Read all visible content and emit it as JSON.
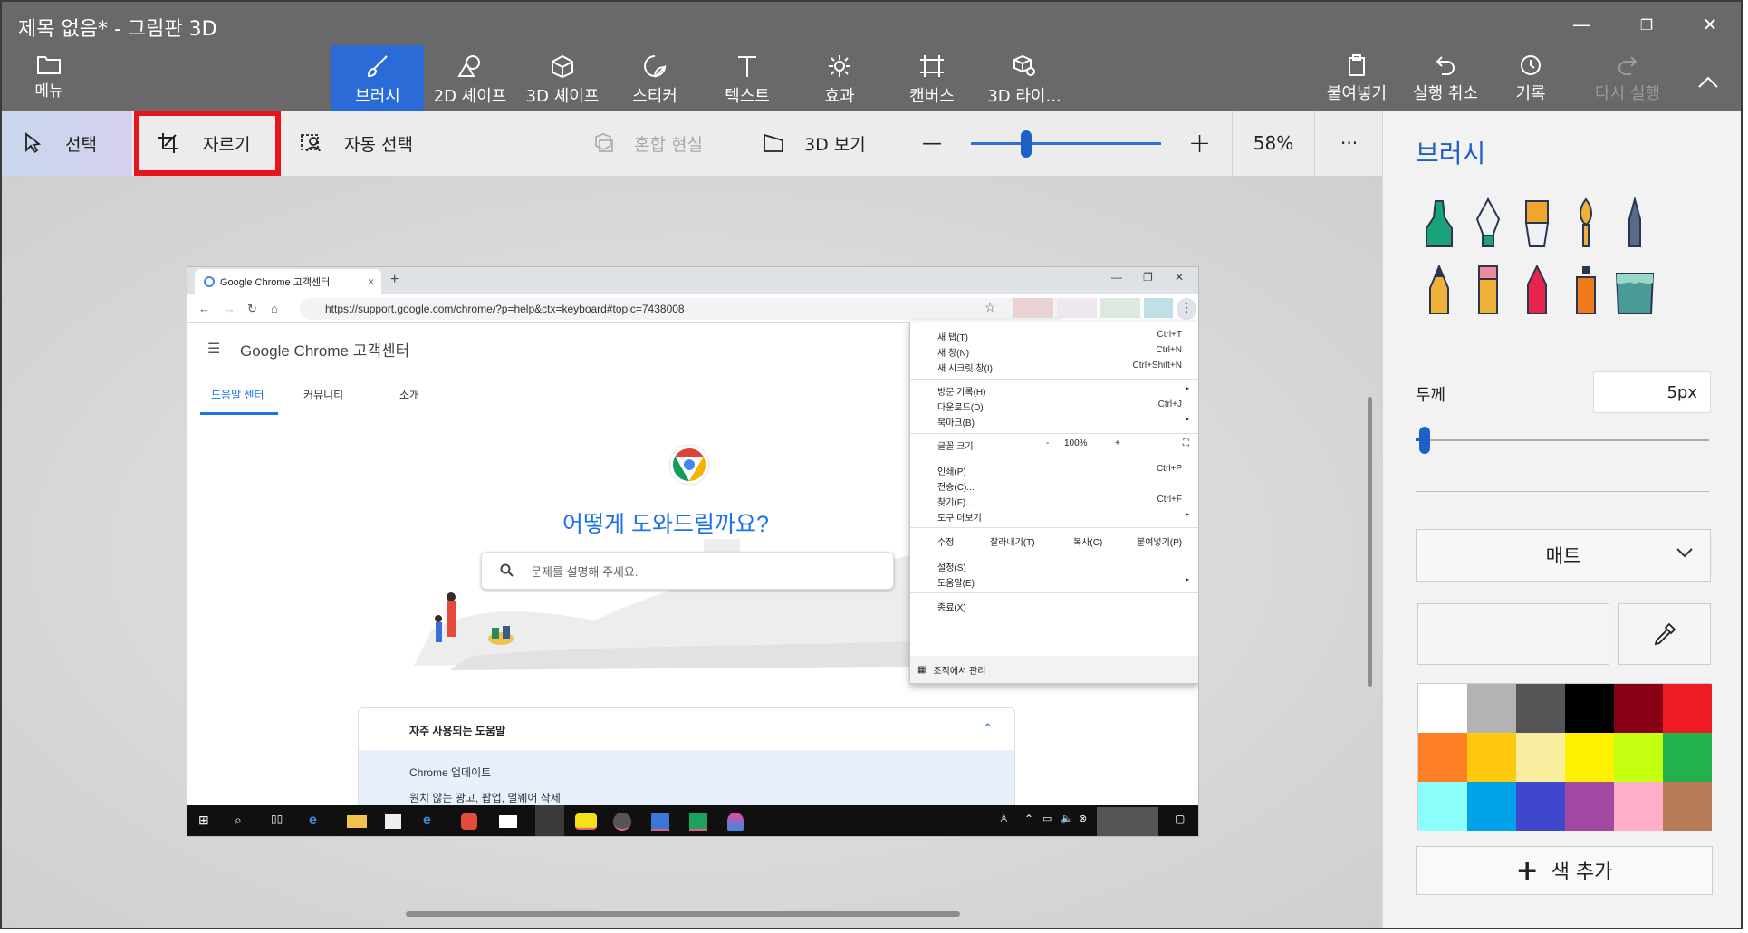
{
  "window": {
    "title": "제목 없음* - 그림판 3D",
    "minimize": "—",
    "restore": "❐",
    "close": "✕"
  },
  "ribbon": {
    "menu_label": "메뉴",
    "tabs": [
      {
        "label": "브러시",
        "icon": "brush-icon",
        "active": true
      },
      {
        "label": "2D 셰이프",
        "icon": "2d-shapes-icon",
        "active": false
      },
      {
        "label": "3D 셰이프",
        "icon": "3d-shapes-icon",
        "active": false
      },
      {
        "label": "스티커",
        "icon": "sticker-icon",
        "active": false
      },
      {
        "label": "텍스트",
        "icon": "text-icon",
        "active": false
      },
      {
        "label": "효과",
        "icon": "effects-icon",
        "active": false
      },
      {
        "label": "캔버스",
        "icon": "canvas-icon",
        "active": false
      },
      {
        "label": "3D 라이...",
        "icon": "3d-library-icon",
        "active": false
      }
    ],
    "paste_label": "붙여넣기",
    "undo_label": "실행 취소",
    "history_label": "기록",
    "redo_label": "다시 실행",
    "collapse_icon": "chevron-up-icon"
  },
  "toolbar": {
    "select_label": "선택",
    "crop_label": "자르기",
    "magic_select_label": "자동 선택",
    "mixed_reality_label": "혼합 현실",
    "view3d_label": "3D 보기",
    "zoom_out": "—",
    "zoom_in": "+",
    "zoom_level": 58,
    "zoom_text": "58%",
    "more": "···"
  },
  "screenshot": {
    "chrome": {
      "tab_title": "Google Chrome 고객센터",
      "tab_close": "×",
      "new_tab": "+",
      "win_min": "—",
      "win_max": "❐",
      "win_close": "✕",
      "url": "https://support.google.com/chrome/?p=help&ctx=keyboard#topic=7438008",
      "bookmark_star": "☆"
    },
    "page": {
      "site_title": "Google Chrome 고객센터",
      "tabs": [
        "도움말 센터",
        "커뮤니티",
        "소개"
      ],
      "heading": "어떻게 도와드릴까요?",
      "search_placeholder": "문제를 설명해 주세요.",
      "faq_title": "자주 사용되는 도움말",
      "faq_items": [
        "Chrome 업데이트",
        "원치 않는 광고, 팝업, 멀웨어 삭제"
      ]
    },
    "menu": {
      "items": [
        {
          "label": "새 탭(T)",
          "shortcut": "Ctrl+T"
        },
        {
          "label": "새 창(N)",
          "shortcut": "Ctrl+N"
        },
        {
          "label": "새 시크릿 창(I)",
          "shortcut": "Ctrl+Shift+N"
        },
        {
          "label": "방문 기록(H)",
          "shortcut": "▸"
        },
        {
          "label": "다운로드(D)",
          "shortcut": "Ctrl+J"
        },
        {
          "label": "북마크(B)",
          "shortcut": "▸"
        },
        {
          "label": "인쇄(P)",
          "shortcut": "Ctrl+P"
        },
        {
          "label": "전송(C)...",
          "shortcut": ""
        },
        {
          "label": "찾기(F)...",
          "shortcut": "Ctrl+F"
        },
        {
          "label": "도구 더보기",
          "shortcut": "▸"
        },
        {
          "label": "설정(S)",
          "shortcut": ""
        },
        {
          "label": "도움말(E)",
          "shortcut": "▸"
        },
        {
          "label": "종료(X)",
          "shortcut": ""
        }
      ],
      "zoom_label": "글꼴 크기",
      "zoom_minus": "-",
      "zoom_value": "100%",
      "zoom_plus": "+",
      "edit_label": "수정",
      "cut": "잘라내기(T)",
      "copy": "복사(C)",
      "paste": "붙여넣기(P)",
      "org_label": "조직에서 관리"
    }
  },
  "panel": {
    "title": "브러시",
    "brushes": [
      {
        "icon": "marker-icon",
        "color": "#1aa37a"
      },
      {
        "icon": "calligraphy-pen-icon",
        "color": "#3a4a6b"
      },
      {
        "icon": "oil-brush-icon",
        "color": "#e8a72e"
      },
      {
        "icon": "watercolor-icon",
        "color": "#f0b13a"
      },
      {
        "icon": "pixel-pen-icon",
        "color": "#5a6a8a"
      },
      {
        "icon": "pencil-icon",
        "color": "#f0b13a"
      },
      {
        "icon": "eraser-icon",
        "color": "#f08a9a"
      },
      {
        "icon": "crayon-icon",
        "color": "#e8244c"
      },
      {
        "icon": "spray-can-icon",
        "color": "#f07a1a"
      },
      {
        "icon": "fill-bucket-icon",
        "color": "#4a9a9a"
      }
    ],
    "thickness_label": "두께",
    "thickness_value": "5px",
    "thickness_fraction": 0.03,
    "finish_label": "매트",
    "add_color_label": "색 추가",
    "palette": [
      "#ffffff",
      "#b3b3b3",
      "#555555",
      "#000000",
      "#880015",
      "#ed1c24",
      "#ff7f27",
      "#ffc90e",
      "#fbeda0",
      "#fff200",
      "#c3ff0e",
      "#22b14c",
      "#8cfffb",
      "#00a2e8",
      "#3f48cc",
      "#a349a4",
      "#ffaec9",
      "#b97a57"
    ]
  }
}
